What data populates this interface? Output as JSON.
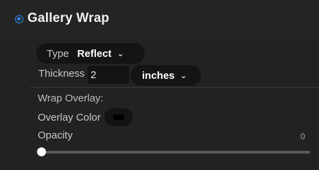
{
  "header": {
    "title": "Gallery Wrap",
    "enabled": true,
    "accent_color": "#2f8cf0"
  },
  "type": {
    "label": "Type",
    "value": "Reflect",
    "chevron_icon": "chevron-down-icon"
  },
  "thickness": {
    "label": "Thickness",
    "value": "2",
    "units": "inches"
  },
  "wrap_overlay": {
    "section_label": "Wrap Overlay:",
    "overlay_color_label": "Overlay Color",
    "overlay_color": "#000000",
    "opacity_label": "Opacity",
    "opacity_value": "0",
    "opacity_level": 0
  }
}
